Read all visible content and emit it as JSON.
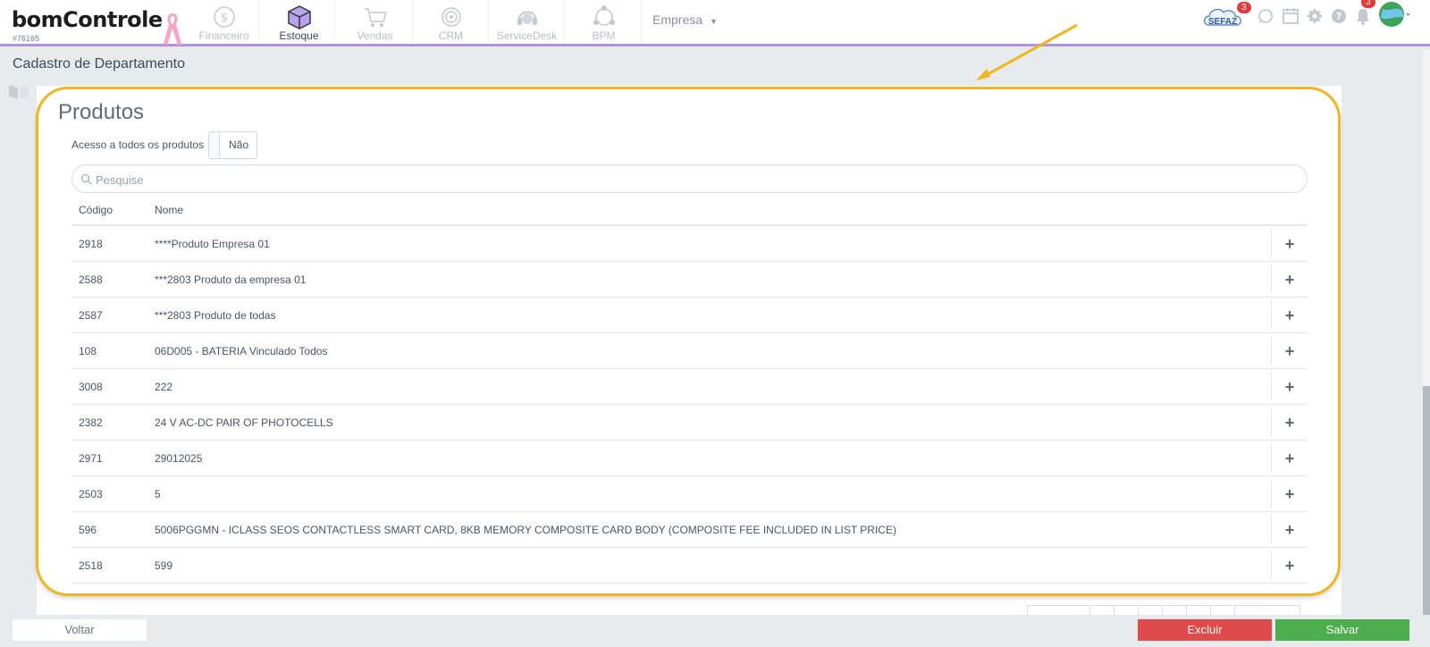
{
  "header": {
    "logo_text": "bomControle",
    "logo_id": "#76165",
    "nav": [
      {
        "label": "Financeiro",
        "icon": "dollar-icon"
      },
      {
        "label": "Estoque",
        "icon": "box-icon",
        "active": true
      },
      {
        "label": "Vendas",
        "icon": "cart-icon"
      },
      {
        "label": "CRM",
        "icon": "target-icon"
      },
      {
        "label": "ServiceDesk",
        "icon": "headset-icon"
      },
      {
        "label": "BPM",
        "icon": "network-icon"
      }
    ],
    "empresa_label": "Empresa",
    "empresa_caret": "▼",
    "sefaz_label": "SEFAZ",
    "sefaz_badge": "3",
    "notification_badge": "3"
  },
  "page": {
    "title": "Cadastro de Departamento"
  },
  "panel": {
    "title": "Produtos",
    "access_label": "Acesso a todos os produtos",
    "toggle_value": "Não",
    "search_placeholder": "Pesquise",
    "columns": {
      "codigo": "Código",
      "nome": "Nome"
    },
    "add_symbol": "+",
    "rows": [
      {
        "codigo": "2918",
        "nome": "****Produto Empresa 01"
      },
      {
        "codigo": "2588",
        "nome": "***2803 Produto da empresa 01"
      },
      {
        "codigo": "2587",
        "nome": "***2803 Produto de todas"
      },
      {
        "codigo": "108",
        "nome": "06D005 - BATERIA Vinculado Todos"
      },
      {
        "codigo": "3008",
        "nome": "222"
      },
      {
        "codigo": "2382",
        "nome": "24 V AC-DC PAIR OF PHOTOCELLS"
      },
      {
        "codigo": "2971",
        "nome": "29012025"
      },
      {
        "codigo": "2503",
        "nome": "5"
      },
      {
        "codigo": "596",
        "nome": "5006PGGMN - ICLASS SEOS CONTACTLESS SMART CARD, 8KB MEMORY COMPOSITE CARD BODY (COMPOSITE FEE INCLUDED IN LIST PRICE)"
      },
      {
        "codigo": "2518",
        "nome": "599"
      }
    ]
  },
  "footer": {
    "voltar": "Voltar",
    "excluir": "Excluir",
    "salvar": "Salvar"
  },
  "colors": {
    "accent_purple": "#b48fe6",
    "highlight_yellow": "#f0b51f",
    "danger": "#df4b4b",
    "success": "#4cae4c"
  }
}
